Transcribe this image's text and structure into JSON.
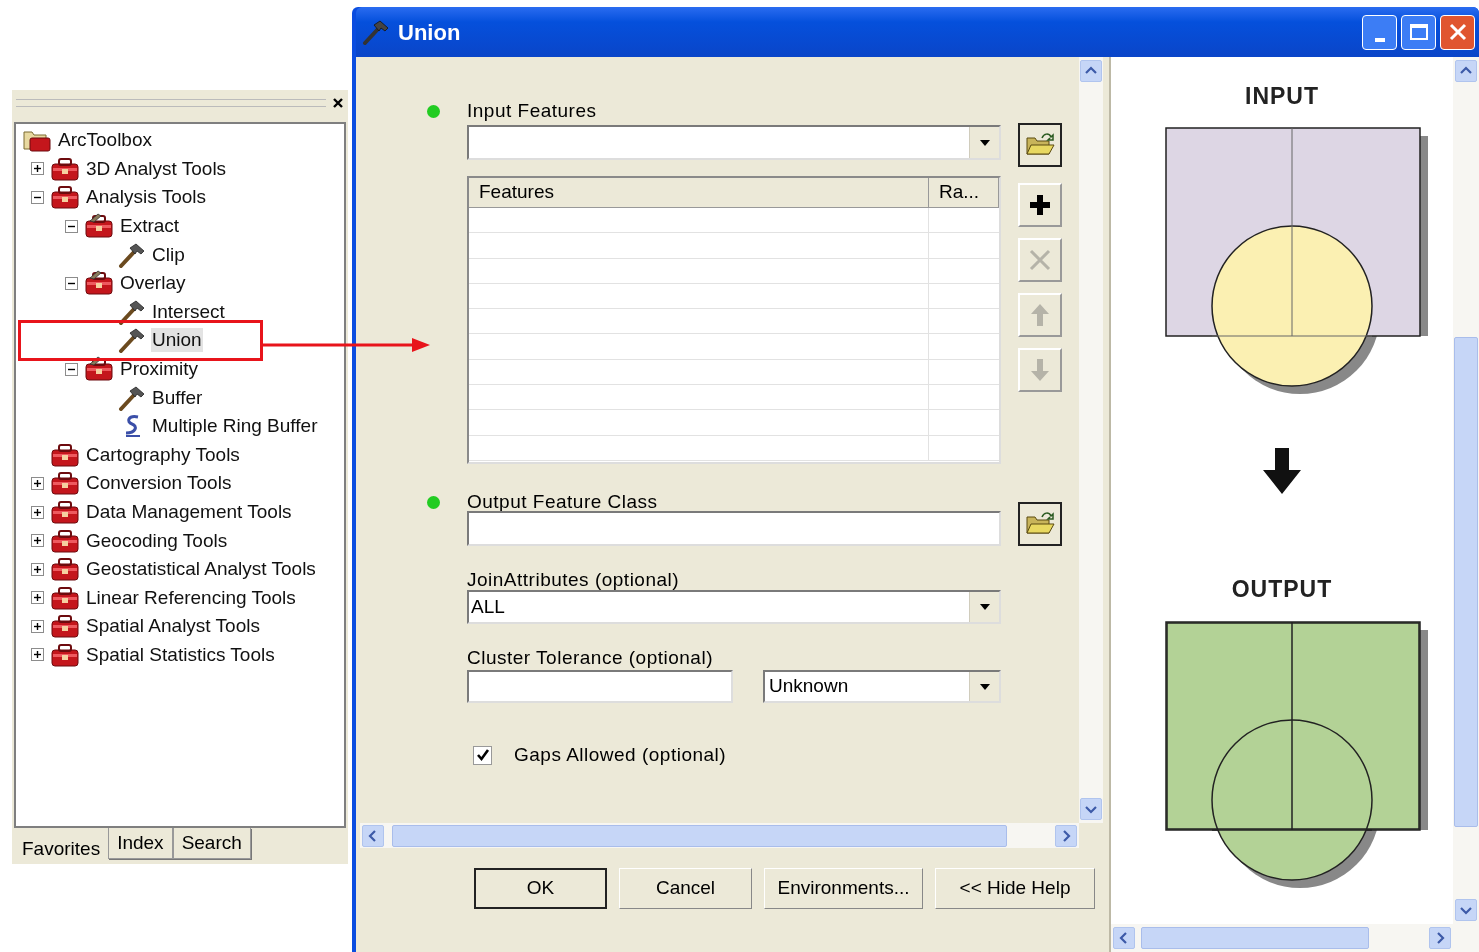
{
  "toolbox_panel": {
    "tree": {
      "label": "ArcToolbox",
      "kind": "root",
      "children": [
        {
          "label": "3D Analyst Tools",
          "kind": "toolbox",
          "expanded": false
        },
        {
          "label": "Analysis Tools",
          "kind": "toolbox",
          "expanded": true,
          "children": [
            {
              "label": "Extract",
              "kind": "toolset",
              "expanded": true,
              "children": [
                {
                  "label": "Clip",
                  "kind": "tool",
                  "selected": false
                }
              ]
            },
            {
              "label": "Overlay",
              "kind": "toolset",
              "expanded": true,
              "children": [
                {
                  "label": "Intersect",
                  "kind": "tool",
                  "selected": false
                },
                {
                  "label": "Union",
                  "kind": "tool",
                  "selected": true
                }
              ]
            },
            {
              "label": "Proximity",
              "kind": "toolset",
              "expanded": true,
              "children": [
                {
                  "label": "Buffer",
                  "kind": "tool",
                  "selected": false
                },
                {
                  "label": "Multiple Ring Buffer",
                  "kind": "script",
                  "selected": false
                }
              ]
            }
          ]
        },
        {
          "label": "Cartography Tools",
          "kind": "toolbox"
        },
        {
          "label": "Conversion Tools",
          "kind": "toolbox",
          "expanded": false
        },
        {
          "label": "Data Management Tools",
          "kind": "toolbox",
          "expanded": false
        },
        {
          "label": "Geocoding Tools",
          "kind": "toolbox",
          "expanded": false
        },
        {
          "label": "Geostatistical Analyst Tools",
          "kind": "toolbox",
          "expanded": false
        },
        {
          "label": "Linear Referencing Tools",
          "kind": "toolbox",
          "expanded": false
        },
        {
          "label": "Spatial Analyst Tools",
          "kind": "toolbox",
          "expanded": false
        },
        {
          "label": "Spatial Statistics Tools",
          "kind": "toolbox",
          "expanded": false
        }
      ]
    },
    "tabs": [
      {
        "label": "Favorites",
        "selected": true
      },
      {
        "label": "Index",
        "selected": false
      },
      {
        "label": "Search",
        "selected": false
      }
    ]
  },
  "dialog": {
    "title": "Union",
    "input_features": {
      "label": "Input Features",
      "required": true,
      "columns": [
        "Features",
        "Ra..."
      ],
      "side_buttons": [
        {
          "kind": "add",
          "disabled": false
        },
        {
          "kind": "remove",
          "disabled": true
        },
        {
          "kind": "up",
          "disabled": true
        },
        {
          "kind": "down",
          "disabled": true
        }
      ]
    },
    "output_feature_class": {
      "label": "Output Feature Class",
      "required": true
    },
    "join_attributes": {
      "label": "JoinAttributes (optional)",
      "value": "ALL"
    },
    "cluster_tolerance": {
      "label": "Cluster Tolerance (optional)",
      "unit": "Unknown"
    },
    "gaps_allowed": {
      "label": "Gaps Allowed (optional)",
      "checked": true
    },
    "buttons": [
      {
        "label": "OK",
        "default": true
      },
      {
        "label": "Cancel",
        "default": false
      },
      {
        "label": "Environments...",
        "default": false
      },
      {
        "label": "<< Hide Help",
        "default": false
      }
    ],
    "help": {
      "input_label": "INPUT",
      "output_label": "OUTPUT"
    }
  }
}
